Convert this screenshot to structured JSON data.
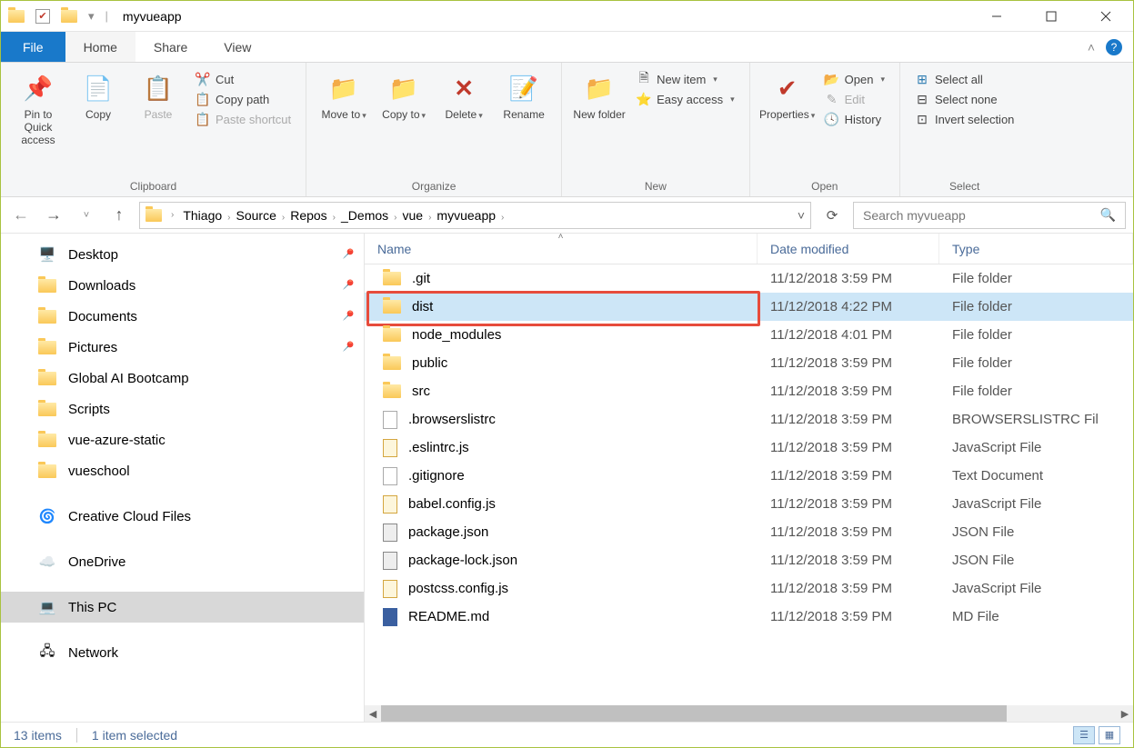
{
  "title": "myvueapp",
  "menu": {
    "file": "File",
    "home": "Home",
    "share": "Share",
    "view": "View"
  },
  "ribbon": {
    "clipboard": {
      "label": "Clipboard",
      "pin": "Pin to Quick access",
      "copy": "Copy",
      "paste": "Paste",
      "cut": "Cut",
      "copypath": "Copy path",
      "pasteshortcut": "Paste shortcut"
    },
    "organize": {
      "label": "Organize",
      "moveto": "Move to",
      "copyto": "Copy to",
      "delete": "Delete",
      "rename": "Rename"
    },
    "new": {
      "label": "New",
      "newfolder": "New folder",
      "newitem": "New item",
      "easyaccess": "Easy access"
    },
    "open": {
      "label": "Open",
      "properties": "Properties",
      "open": "Open",
      "edit": "Edit",
      "history": "History"
    },
    "select": {
      "label": "Select",
      "all": "Select all",
      "none": "Select none",
      "invert": "Invert selection"
    }
  },
  "breadcrumbs": [
    "Thiago",
    "Source",
    "Repos",
    "_Demos",
    "vue",
    "myvueapp"
  ],
  "search_placeholder": "Search myvueapp",
  "tree": [
    {
      "label": "Desktop",
      "icon": "desktop",
      "pin": true,
      "lvl": 1
    },
    {
      "label": "Downloads",
      "icon": "folder",
      "pin": true,
      "lvl": 1
    },
    {
      "label": "Documents",
      "icon": "folder",
      "pin": true,
      "lvl": 1
    },
    {
      "label": "Pictures",
      "icon": "folder",
      "pin": true,
      "lvl": 1
    },
    {
      "label": "Global AI Bootcamp",
      "icon": "folder",
      "pin": false,
      "lvl": 1
    },
    {
      "label": "Scripts",
      "icon": "folder",
      "pin": false,
      "lvl": 1
    },
    {
      "label": "vue-azure-static",
      "icon": "folder",
      "pin": false,
      "lvl": 1
    },
    {
      "label": "vueschool",
      "icon": "folder",
      "pin": false,
      "lvl": 1
    },
    {
      "spacer": true
    },
    {
      "label": "Creative Cloud Files",
      "icon": "cc",
      "pin": false,
      "lvl": 0
    },
    {
      "spacer": true
    },
    {
      "label": "OneDrive",
      "icon": "onedrive",
      "pin": false,
      "lvl": 0
    },
    {
      "spacer": true
    },
    {
      "label": "This PC",
      "icon": "pc",
      "pin": false,
      "lvl": 0,
      "selected": true
    },
    {
      "spacer": true
    },
    {
      "label": "Network",
      "icon": "network",
      "pin": false,
      "lvl": 0
    }
  ],
  "columns": {
    "name": "Name",
    "date": "Date modified",
    "type": "Type"
  },
  "files": [
    {
      "name": ".git",
      "date": "11/12/2018 3:59 PM",
      "type": "File folder",
      "icon": "folder"
    },
    {
      "name": "dist",
      "date": "11/12/2018 4:22 PM",
      "type": "File folder",
      "icon": "folder",
      "selected": true,
      "highlight": true
    },
    {
      "name": "node_modules",
      "date": "11/12/2018 4:01 PM",
      "type": "File folder",
      "icon": "folder"
    },
    {
      "name": "public",
      "date": "11/12/2018 3:59 PM",
      "type": "File folder",
      "icon": "folder"
    },
    {
      "name": "src",
      "date": "11/12/2018 3:59 PM",
      "type": "File folder",
      "icon": "folder"
    },
    {
      "name": ".browserslistrc",
      "date": "11/12/2018 3:59 PM",
      "type": "BROWSERSLISTRC Fil",
      "icon": "file"
    },
    {
      "name": ".eslintrc.js",
      "date": "11/12/2018 3:59 PM",
      "type": "JavaScript File",
      "icon": "js"
    },
    {
      "name": ".gitignore",
      "date": "11/12/2018 3:59 PM",
      "type": "Text Document",
      "icon": "file"
    },
    {
      "name": "babel.config.js",
      "date": "11/12/2018 3:59 PM",
      "type": "JavaScript File",
      "icon": "js"
    },
    {
      "name": "package.json",
      "date": "11/12/2018 3:59 PM",
      "type": "JSON File",
      "icon": "json"
    },
    {
      "name": "package-lock.json",
      "date": "11/12/2018 3:59 PM",
      "type": "JSON File",
      "icon": "json"
    },
    {
      "name": "postcss.config.js",
      "date": "11/12/2018 3:59 PM",
      "type": "JavaScript File",
      "icon": "js"
    },
    {
      "name": "README.md",
      "date": "11/12/2018 3:59 PM",
      "type": "MD File",
      "icon": "md"
    }
  ],
  "status": {
    "items": "13 items",
    "selected": "1 item selected"
  }
}
